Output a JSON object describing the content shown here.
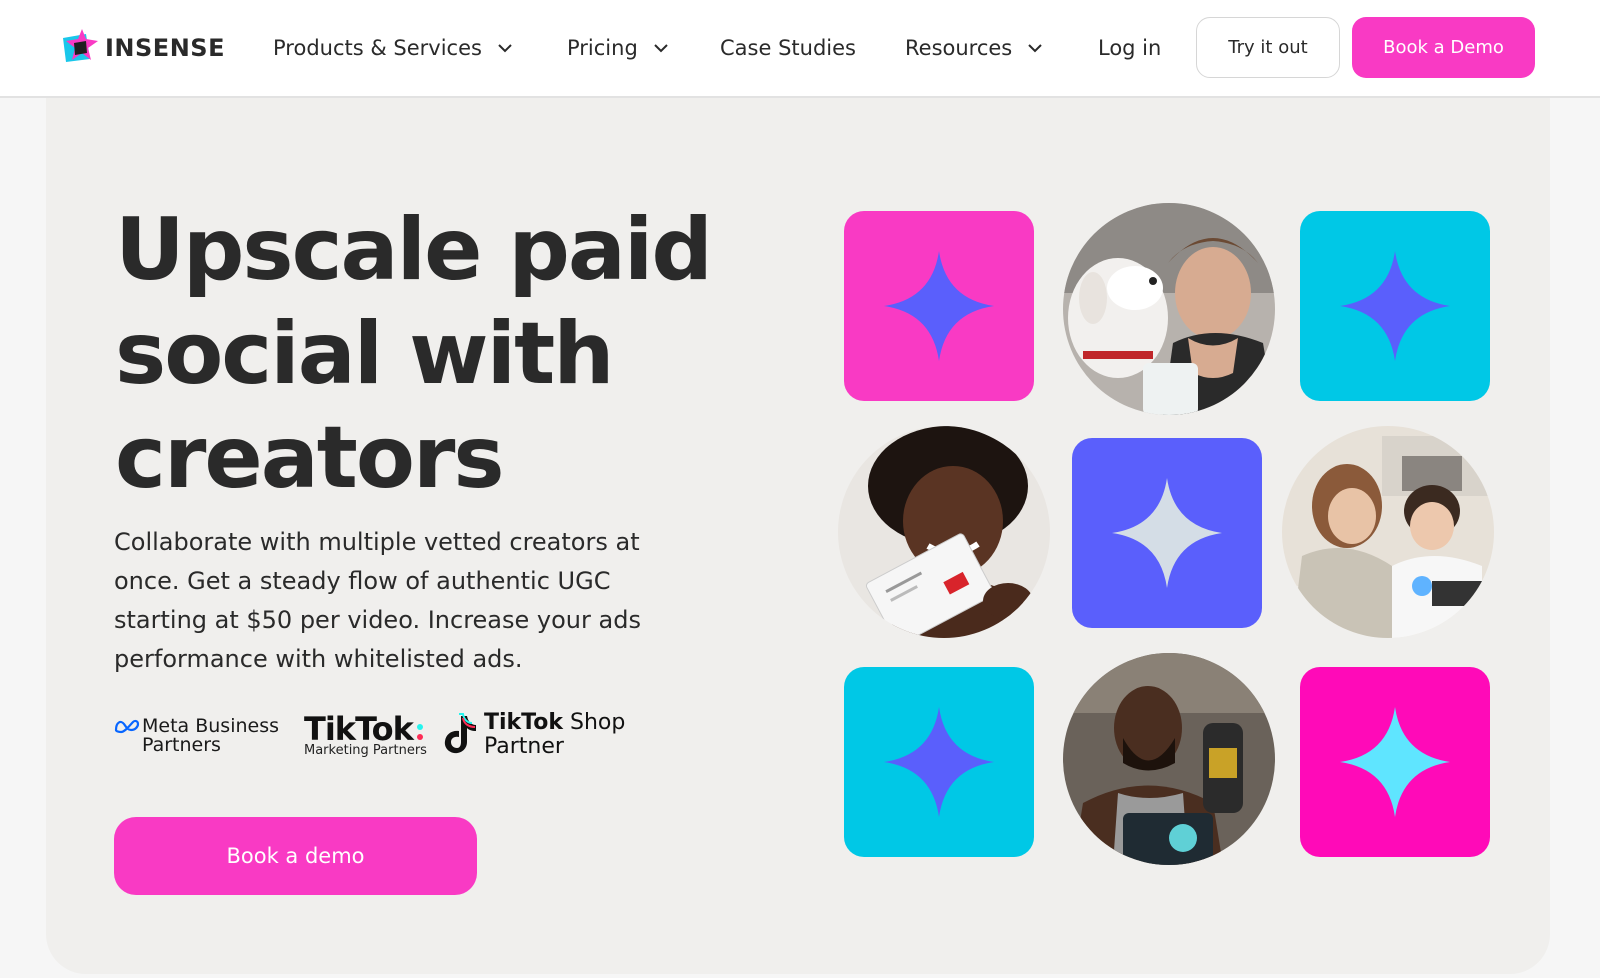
{
  "brand": {
    "name": "INSENSE"
  },
  "nav": {
    "items": [
      {
        "label": "Products & Services",
        "has_dropdown": true
      },
      {
        "label": "Pricing",
        "has_dropdown": true
      },
      {
        "label": "Case Studies",
        "has_dropdown": false
      },
      {
        "label": "Resources",
        "has_dropdown": true
      }
    ],
    "login_label": "Log in",
    "try_label": "Try it out",
    "demo_label": "Book a Demo"
  },
  "hero": {
    "headline": "Upscale paid social with creators",
    "subtext": "Collaborate with multiple vetted creators at once. Get a steady flow of authentic UGC starting at $50 per video. Increase your ads performance with whitelisted ads.",
    "cta_label": "Book a demo"
  },
  "partners": {
    "meta_line1": "Meta Business",
    "meta_line2": "Partners",
    "tiktok_name": "TikTok",
    "tiktok_sub": "Marketing Partners",
    "shop_brand": "TikTok",
    "shop_word": "Shop",
    "shop_line2": "Partner"
  },
  "colors": {
    "accent_pink": "#f93ac4",
    "cyan": "#00c8e6",
    "purple": "#5a5ffc",
    "magenta": "#ff0ab8",
    "hero_bg": "#f0efed"
  },
  "tiles": [
    {
      "kind": "tile",
      "bg": "#f93ac4",
      "star": "#5a5ffc"
    },
    {
      "kind": "photo",
      "subject": "woman with dog"
    },
    {
      "kind": "tile",
      "bg": "#00c8e6",
      "star": "#5a5ffc"
    },
    {
      "kind": "photo",
      "subject": "smiling woman with product box"
    },
    {
      "kind": "tile",
      "bg": "#5a5ffc",
      "star": "#d4dde6"
    },
    {
      "kind": "photo",
      "subject": "two kids with kit"
    },
    {
      "kind": "tile",
      "bg": "#00c8e6",
      "star": "#5a5ffc"
    },
    {
      "kind": "photo",
      "subject": "man holding products"
    },
    {
      "kind": "tile",
      "bg": "#ff0ab8",
      "star": "#5fe5ff"
    }
  ]
}
